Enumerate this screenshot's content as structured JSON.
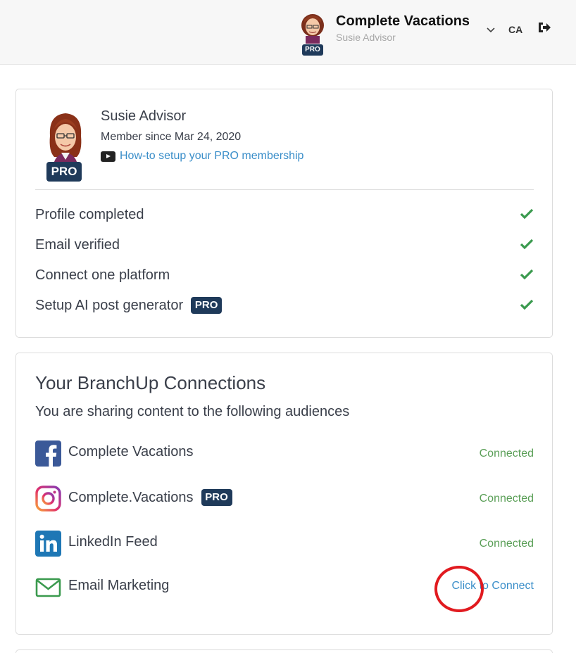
{
  "header": {
    "account_title": "Complete Vacations",
    "account_user": "Susie Advisor",
    "pro_badge": "PRO",
    "locale": "CA"
  },
  "profile": {
    "name": "Susie Advisor",
    "member_since": "Member since Mar 24, 2020",
    "howto_link": "How-to setup your PRO membership",
    "pro_badge": "PRO"
  },
  "checklist": [
    {
      "label": "Profile completed",
      "done": true
    },
    {
      "label": "Email verified",
      "done": true
    },
    {
      "label": "Connect one platform",
      "done": true
    },
    {
      "label": "Setup AI post generator",
      "pro": "PRO",
      "done": true
    }
  ],
  "connections": {
    "title": "Your BranchUp Connections",
    "subtitle": "You are sharing content to the following audiences",
    "items": [
      {
        "icon": "facebook-icon",
        "label": "Complete Vacations",
        "status": "Connected"
      },
      {
        "icon": "instagram-icon",
        "label": "Complete.Vacations",
        "pro": "PRO",
        "status": "Connected"
      },
      {
        "icon": "linkedin-icon",
        "label": "LinkedIn Feed",
        "status": "Connected"
      },
      {
        "icon": "email-icon",
        "label": "Email Marketing",
        "action": "Click to Connect"
      }
    ]
  },
  "colors": {
    "pro_badge": "#1f3a5a",
    "connected": "#5a9f57",
    "link": "#3a8ec9",
    "check": "#3a9a4e",
    "annotation_circle": "#e11a1f"
  }
}
